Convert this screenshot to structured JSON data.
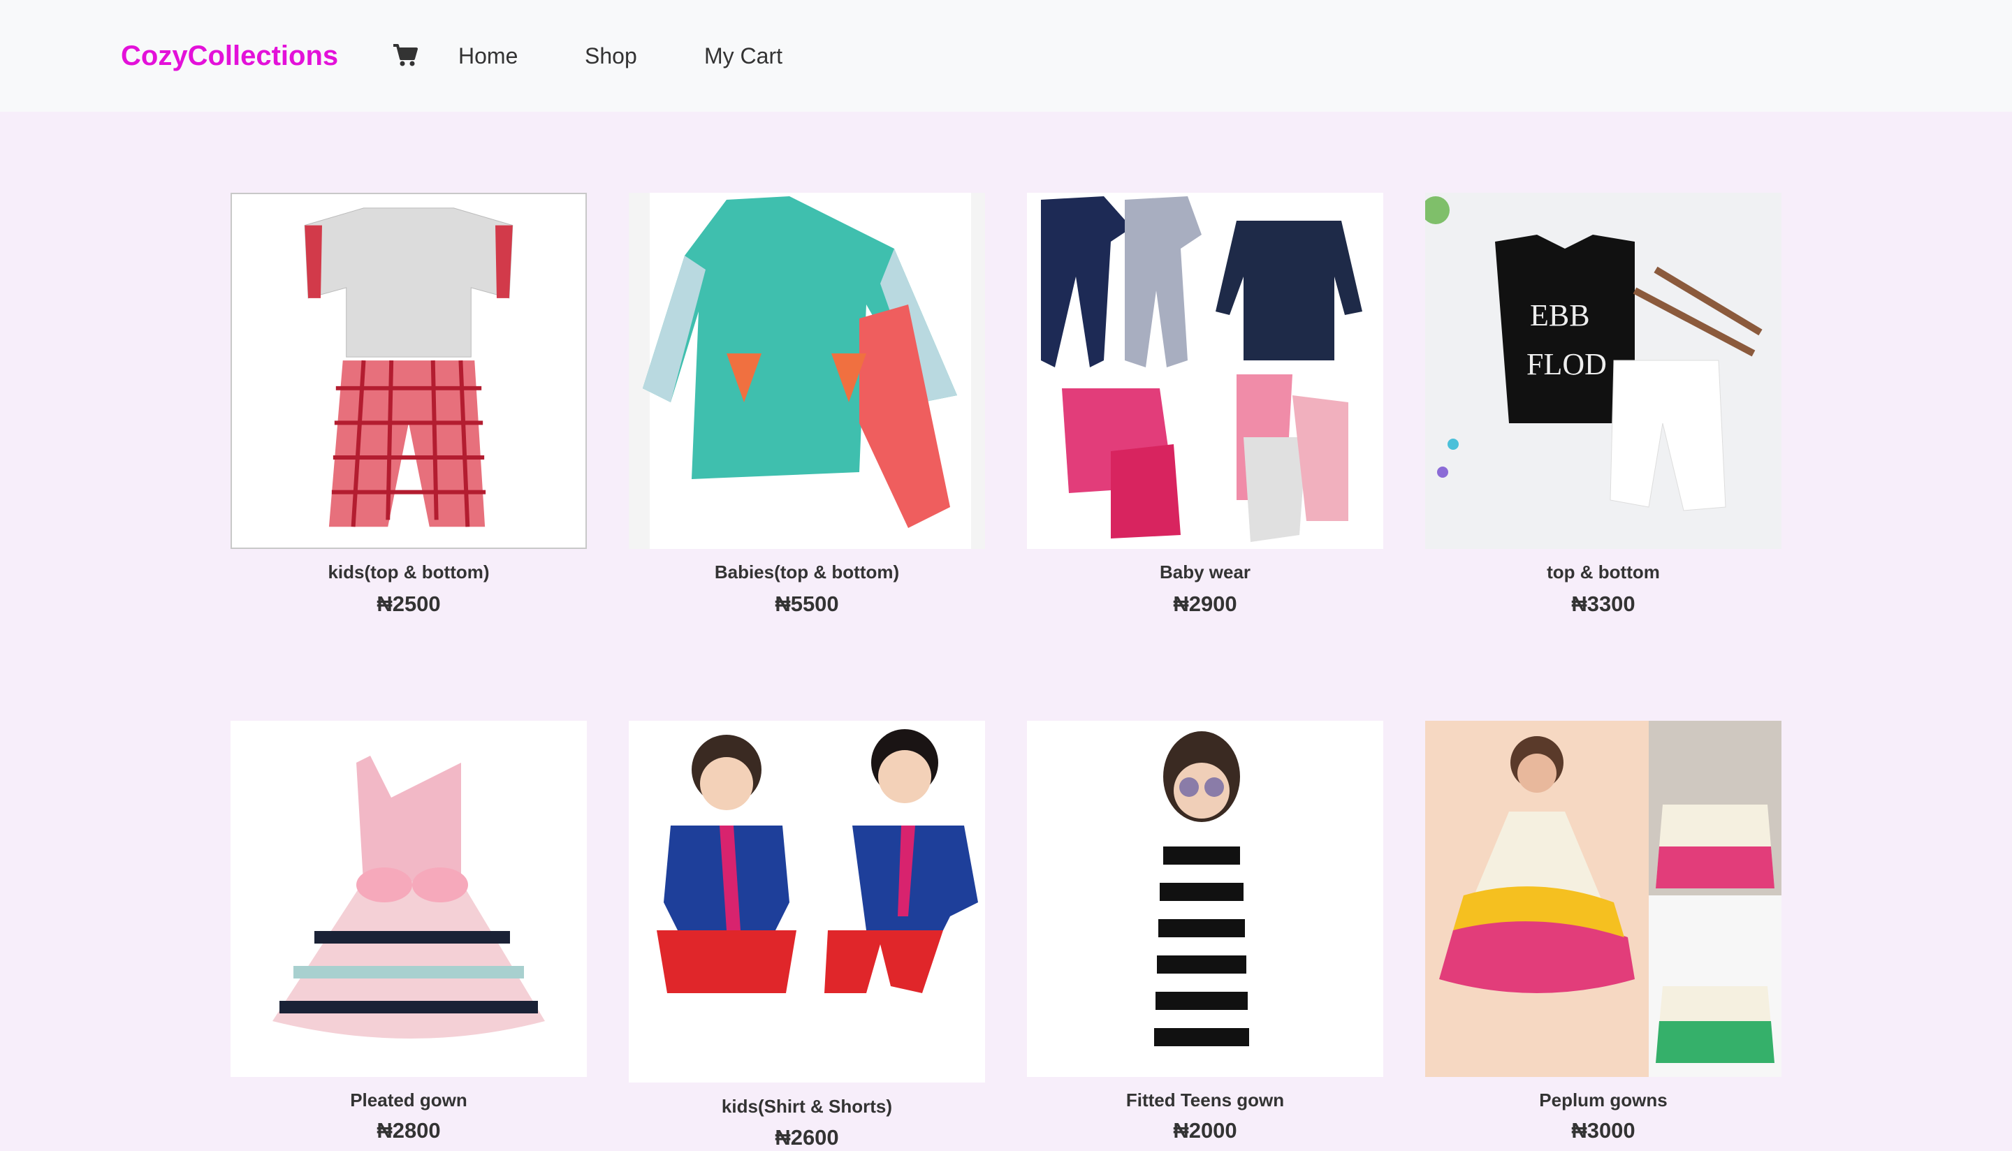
{
  "brand": "CozyCollections",
  "nav": {
    "cart_icon": "shopping-cart-icon",
    "home": "Home",
    "shop": "Shop",
    "my_cart": "My Cart"
  },
  "colors": {
    "brand": "#e311d9",
    "page_background": "#f7eefa",
    "navbar_background": "#f8f9fa"
  },
  "products": [
    {
      "name": "kids(top & bottom)",
      "price": "₦2500"
    },
    {
      "name": "Babies(top & bottom)",
      "price": "₦5500"
    },
    {
      "name": "Baby wear",
      "price": "₦2900"
    },
    {
      "name": "top & bottom",
      "price": "₦3300"
    },
    {
      "name": "Pleated gown",
      "price": "₦2800"
    },
    {
      "name": "kids(Shirt & Shorts)",
      "price": "₦2600"
    },
    {
      "name": "Fitted Teens gown",
      "price": "₦2000"
    },
    {
      "name": "Peplum gowns",
      "price": "₦3000"
    }
  ]
}
